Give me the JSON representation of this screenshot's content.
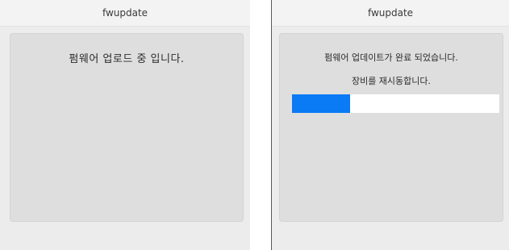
{
  "windows": [
    {
      "title": "fwupdate",
      "message": "펌웨어 업로드 중 입니다."
    },
    {
      "title": "fwupdate",
      "message": "펌웨어 업데이트가 완료 되었습니다.",
      "message2": "장비를 재시동합니다.",
      "progress_fraction": 0.28
    }
  ],
  "colors": {
    "progress_fill": "#0a7af5",
    "panel_bg": "#dedede",
    "window_bg": "#ececec"
  }
}
